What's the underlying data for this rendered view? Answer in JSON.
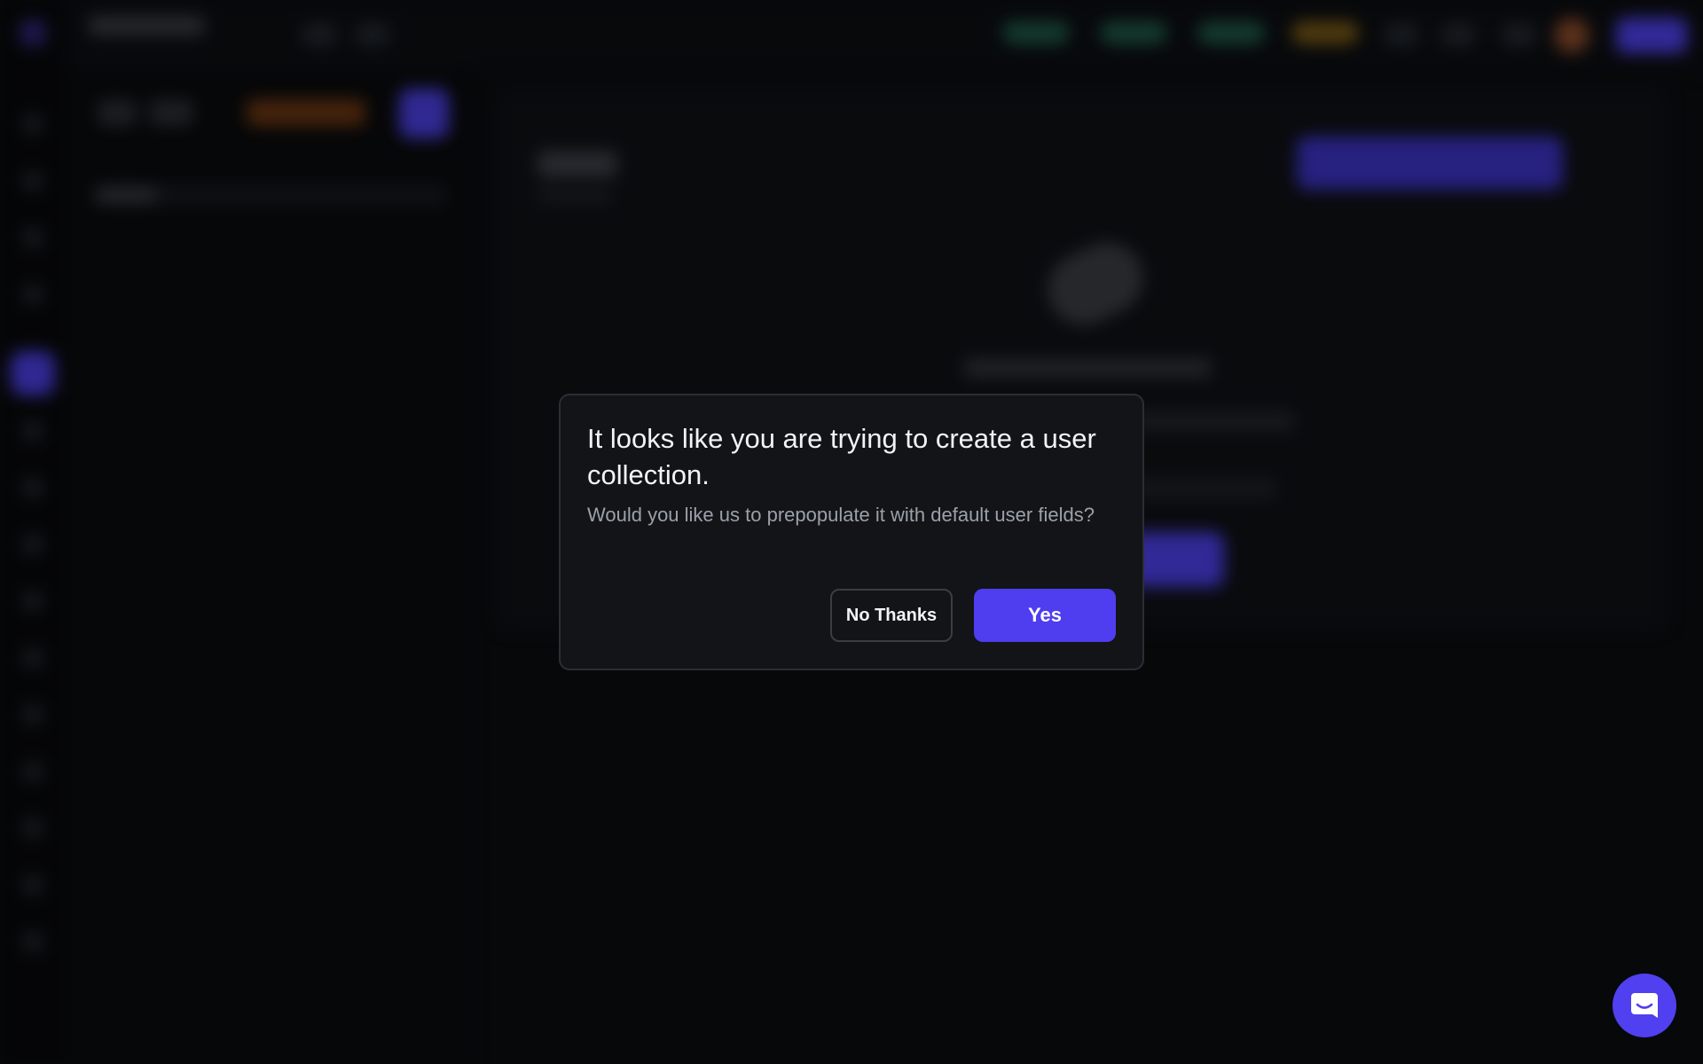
{
  "colors": {
    "accent": "#4f3df0",
    "modal_background": "#121417",
    "page_background": "#0b0d10"
  },
  "dialog": {
    "title": "It looks like you are trying to create a user collection.",
    "message": "Would you like us to prepopulate it with default user fields?",
    "secondary_label": "No Thanks",
    "primary_label": "Yes"
  },
  "icons": {
    "chat_launcher": "chat-bubble-icon"
  }
}
